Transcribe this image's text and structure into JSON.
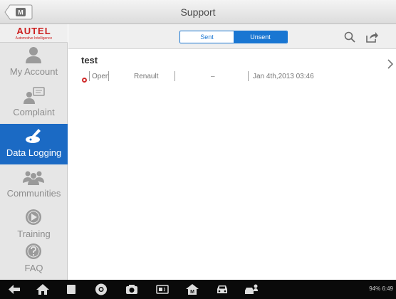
{
  "window": {
    "title": "Support"
  },
  "logo": {
    "brand": "AUTEL",
    "tagline": "Automotive Intelligence"
  },
  "sidebar": {
    "items": [
      {
        "label": "My Account",
        "icon": "person-icon",
        "active": false
      },
      {
        "label": "Complaint",
        "icon": "complaint-icon",
        "active": false
      },
      {
        "label": "Data Logging",
        "icon": "data-logging-icon",
        "active": true
      },
      {
        "label": "Communities",
        "icon": "communities-icon",
        "active": false
      },
      {
        "label": "Training",
        "icon": "play-icon",
        "active": false
      },
      {
        "label": "FAQ",
        "icon": "question-icon",
        "active": false
      }
    ]
  },
  "toolbar": {
    "tabs": [
      {
        "label": "Sent",
        "selected": false
      },
      {
        "label": "Unsent",
        "selected": true
      }
    ],
    "icons": [
      "search-icon",
      "share-icon"
    ]
  },
  "list": {
    "rows": [
      {
        "title": "test",
        "status": "Open",
        "make": "Renault",
        "model": "",
        "detail": "–",
        "date": "Jan 4th,2013 03:46"
      }
    ]
  },
  "navbar": {
    "icons": [
      "back-icon",
      "home-icon",
      "recent-apps-icon",
      "browser-icon",
      "camera-icon",
      "vci-icon",
      "autel-home-icon",
      "car-icon",
      "car-person-icon"
    ],
    "status": "94% 6:49"
  },
  "colors": {
    "accent": "#1976d2",
    "active_sidebar": "#1b6ac4",
    "brand_red": "#cc1f1f",
    "navbar": "#0a0a0a"
  }
}
